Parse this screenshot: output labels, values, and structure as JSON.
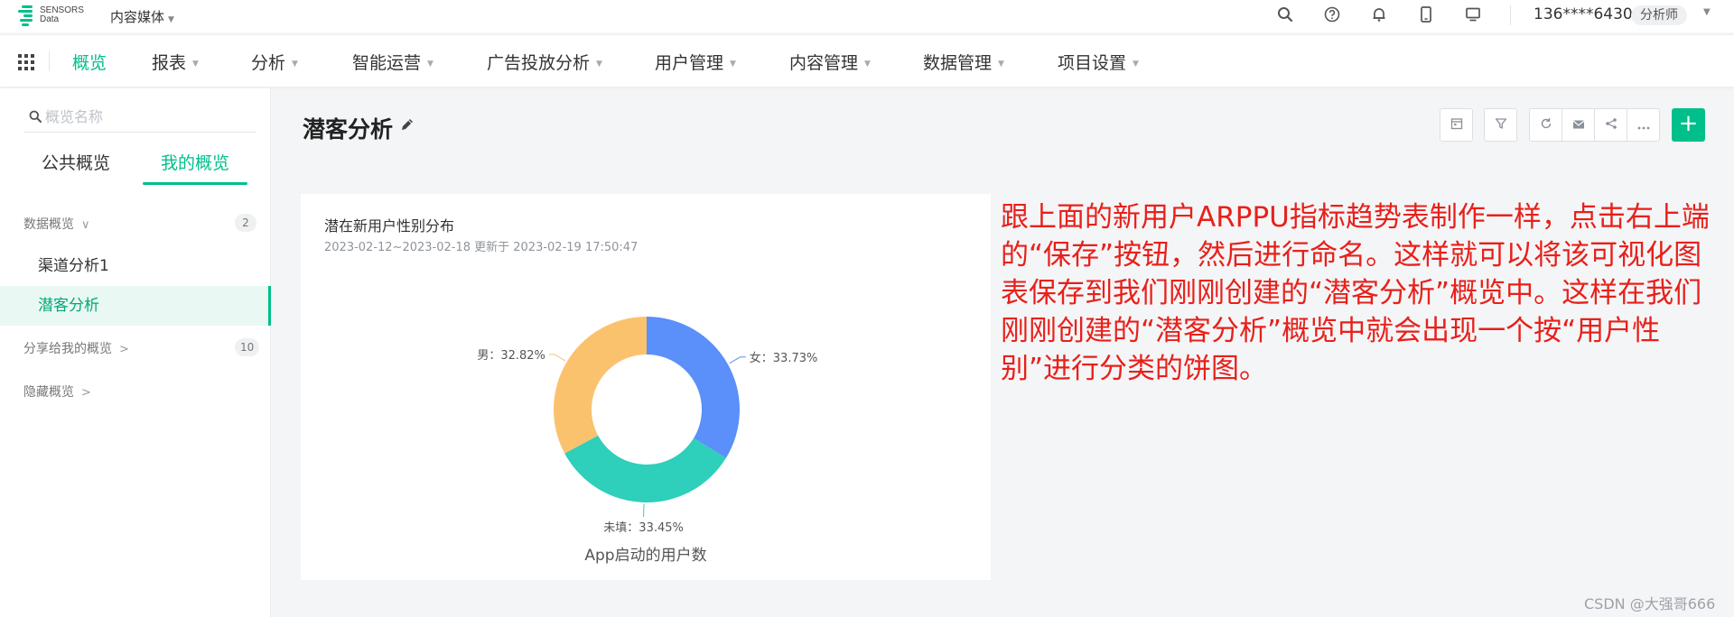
{
  "topbar": {
    "logo_text_line1": "SENSORS",
    "logo_text_line2": "Data",
    "project_name": "内容媒体",
    "icons": [
      "search-icon",
      "help-icon",
      "bell-icon",
      "mobile-icon",
      "monitor-icon"
    ],
    "user_phone": "136****6430",
    "user_role": "分析师"
  },
  "nav": {
    "items": [
      {
        "label": "概览",
        "active": true,
        "dropdown": false
      },
      {
        "label": "报表",
        "dropdown": true
      },
      {
        "label": "分析",
        "dropdown": true
      },
      {
        "label": "智能运营",
        "dropdown": true
      },
      {
        "label": "广告投放分析",
        "dropdown": true
      },
      {
        "label": "用户管理",
        "dropdown": true
      },
      {
        "label": "内容管理",
        "dropdown": true
      },
      {
        "label": "数据管理",
        "dropdown": true
      },
      {
        "label": "项目设置",
        "dropdown": true
      }
    ]
  },
  "sidebar": {
    "search_placeholder": "概览名称",
    "tabs": [
      {
        "label": "公共概览",
        "active": false
      },
      {
        "label": "我的概览",
        "active": true
      }
    ],
    "groups": [
      {
        "label": "数据概览",
        "count": "2",
        "expanded": true
      },
      {
        "label": "分享给我的概览",
        "count": "10",
        "expanded": false
      },
      {
        "label": "隐藏概览",
        "expanded": false
      }
    ],
    "items": [
      {
        "label": "渠道分析1",
        "active": false
      },
      {
        "label": "潜客分析",
        "active": true
      }
    ]
  },
  "main": {
    "title": "潜客分析",
    "toolbar_icons": [
      "calendar-icon",
      "filter-icon",
      "refresh-icon",
      "mail-icon",
      "share-icon",
      "more-icon"
    ],
    "add_label": "+"
  },
  "card": {
    "title": "潜在新用户性别分布",
    "subtitle": "2023-02-12~2023-02-18 更新于 2023-02-19 17:50:47",
    "caption": "App启动的用户数"
  },
  "chart_data": {
    "type": "pie",
    "donut": true,
    "title": "潜在新用户性别分布",
    "series_label": "App启动的用户数",
    "slices": [
      {
        "label": "女",
        "value": 33.73,
        "display": "女：33.73%",
        "color": "#5b8ff9"
      },
      {
        "label": "未填",
        "value": 33.45,
        "display": "未填：33.45%",
        "color": "#2ecfbb"
      },
      {
        "label": "男",
        "value": 32.82,
        "display": "男：32.82%",
        "color": "#fbc26e"
      }
    ]
  },
  "annotation": {
    "text": "跟上面的新用户ARPPU指标趋势表制作一样，点击右上端的“保存”按钮，然后进行命名。这样就可以将该可视化图表保存到我们刚刚创建的“潜客分析”概览中。这样在我们刚刚创建的“潜客分析”概览中就会出现一个按“用户性别”进行分类的饼图。"
  },
  "watermark": "CSDN @大强哥666"
}
